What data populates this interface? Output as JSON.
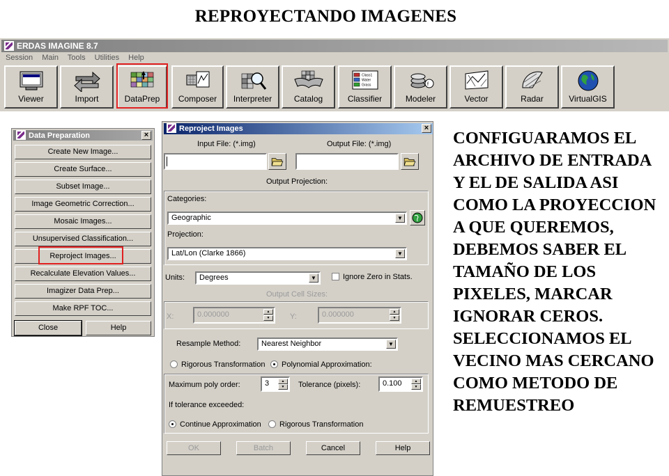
{
  "slide": {
    "title": "REPROYECTANDO IMAGENES",
    "explanation": "CONFIGUARAMOS EL ARCHIVO DE ENTRADA Y EL DE SALIDA ASI COMO LA PROYECCION A QUE QUEREMOS, DEBEMOS SABER EL TAMAÑO DE LOS PIXELES, MARCAR IGNORAR CEROS. SELECCIONAMOS EL VECINO MAS CERCANO COMO METODO DE REMUESTREO"
  },
  "erdas": {
    "title": "ERDAS IMAGINE 8.7",
    "menu": [
      "Session",
      "Main",
      "Tools",
      "Utilities",
      "Help"
    ],
    "toolbar": [
      {
        "label": "Viewer",
        "icon": "monitor-icon"
      },
      {
        "label": "Import",
        "icon": "import-export-arrows-icon"
      },
      {
        "label": "DataPrep",
        "icon": "dataprep-grid-icon"
      },
      {
        "label": "Composer",
        "icon": "composer-map-icon"
      },
      {
        "label": "Interpreter",
        "icon": "interpreter-magnifier-icon"
      },
      {
        "label": "Catalog",
        "icon": "catalog-book-icon"
      },
      {
        "label": "Classifier",
        "icon": "classifier-legend-icon"
      },
      {
        "label": "Modeler",
        "icon": "modeler-stack-icon"
      },
      {
        "label": "Vector",
        "icon": "vector-map-icon"
      },
      {
        "label": "Radar",
        "icon": "radar-dish-icon"
      },
      {
        "label": "VirtualGIS",
        "icon": "globe-icon"
      }
    ],
    "classifier_legend": [
      "Class1",
      "Water",
      "Grass"
    ],
    "highlight_color": "#e02020"
  },
  "data_prep": {
    "title": "Data Preparation",
    "buttons": [
      "Create New Image...",
      "Create Surface...",
      "Subset Image...",
      "Image Geometric Correction...",
      "Mosaic Images...",
      "Unsupervised Classification...",
      "Reproject Images...",
      "Recalculate Elevation Values...",
      "Imagizer Data Prep...",
      "Make RPF TOC..."
    ],
    "close_label": "Close",
    "help_label": "Help"
  },
  "reproject": {
    "title": "Reproject Images",
    "input_file_label": "Input File: (*.img)",
    "input_file_value": "",
    "output_file_label": "Output File: (*.img)",
    "output_file_value": "",
    "output_projection_label": "Output Projection:",
    "categories_label": "Categories:",
    "categories_value": "Geographic",
    "projection_label": "Projection:",
    "projection_value": "Lat/Lon (Clarke 1866)",
    "units_label": "Units:",
    "units_value": "Degrees",
    "ignore_zero_label": "Ignore Zero in Stats.",
    "ignore_zero_checked": false,
    "output_cell_sizes_label": "Output Cell Sizes:",
    "x_label": "X:",
    "x_value": "0.000000",
    "y_label": "Y:",
    "y_value": "0.000000",
    "resample_label": "Resample Method:",
    "resample_value": "Nearest Neighbor",
    "rigorous_transformation_label": "Rigorous Transformation",
    "polynomial_approx_label": "Polynomial Approximation:",
    "method_selected": "Polynomial Approximation",
    "max_poly_label": "Maximum poly order:",
    "max_poly_value": "3",
    "tolerance_label": "Tolerance (pixels):",
    "tolerance_value": "0.100",
    "if_exceeded_label": "If tolerance exceeded:",
    "continue_approx_label": "Continue Approximation",
    "rigorous_transformation_label_2": "Rigorous Transformation",
    "exceeded_selected": "Continue Approximation",
    "ok_label": "OK",
    "batch_label": "Batch",
    "cancel_label": "Cancel",
    "help_label": "Help"
  }
}
